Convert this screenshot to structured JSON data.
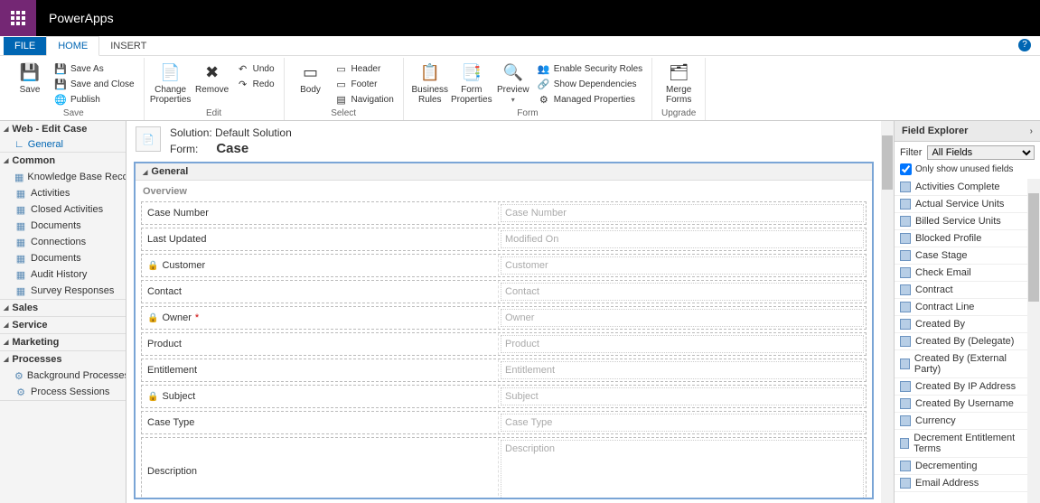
{
  "app_title": "PowerApps",
  "tabs": {
    "file": "FILE",
    "home": "HOME",
    "insert": "INSERT"
  },
  "ribbon": {
    "save": {
      "save": "Save",
      "saveas": "Save As",
      "saveclose": "Save and Close",
      "publish": "Publish",
      "group": "Save"
    },
    "edit": {
      "change": "Change Properties",
      "remove": "Remove",
      "undo": "Undo",
      "redo": "Redo",
      "group": "Edit"
    },
    "select": {
      "body": "Body",
      "header": "Header",
      "footer": "Footer",
      "nav": "Navigation",
      "group": "Select"
    },
    "form": {
      "rules": "Business Rules",
      "props": "Form Properties",
      "preview": "Preview",
      "security": "Enable Security Roles",
      "deps": "Show Dependencies",
      "managed": "Managed Properties",
      "group": "Form"
    },
    "upgrade": {
      "merge": "Merge Forms",
      "group": "Upgrade"
    }
  },
  "leftpane": {
    "web": "Web - Edit Case",
    "general": "General",
    "common": {
      "head": "Common",
      "items": [
        "Knowledge Base Reco...",
        "Activities",
        "Closed Activities",
        "Documents",
        "Connections",
        "Documents",
        "Audit History",
        "Survey Responses"
      ]
    },
    "sales": "Sales",
    "service": "Service",
    "marketing": "Marketing",
    "processes": {
      "head": "Processes",
      "items": [
        "Background Processes",
        "Process Sessions"
      ]
    }
  },
  "canvas": {
    "solution_label": "Solution:",
    "solution": "Default Solution",
    "form_label": "Form:",
    "form": "Case",
    "section": "General",
    "overview": "Overview",
    "fields": [
      {
        "label": "Case Number",
        "ph": "Case Number",
        "req": false
      },
      {
        "label": "Last Updated",
        "ph": "Modified On",
        "req": false
      },
      {
        "label": "Customer",
        "ph": "Customer",
        "req": true
      },
      {
        "label": "Contact",
        "ph": "Contact",
        "req": false
      },
      {
        "label": "Owner",
        "ph": "Owner",
        "req": true,
        "star": true
      },
      {
        "label": "Product",
        "ph": "Product",
        "req": false
      },
      {
        "label": "Entitlement",
        "ph": "Entitlement",
        "req": false
      },
      {
        "label": "Subject",
        "ph": "Subject",
        "req": true
      },
      {
        "label": "Case Type",
        "ph": "Case Type",
        "req": false
      },
      {
        "label": "Description",
        "ph": "Description",
        "req": false,
        "tall": true
      }
    ]
  },
  "fieldexplorer": {
    "title": "Field Explorer",
    "filter_label": "Filter",
    "filter_value": "All Fields",
    "unused_label": "Only show unused fields",
    "unused_checked": true,
    "items": [
      "Activities Complete",
      "Actual Service Units",
      "Billed Service Units",
      "Blocked Profile",
      "Case Stage",
      "Check Email",
      "Contract",
      "Contract Line",
      "Created By",
      "Created By (Delegate)",
      "Created By (External Party)",
      "Created By IP Address",
      "Created By Username",
      "Currency",
      "Decrement Entitlement Terms",
      "Decrementing",
      "Email Address"
    ]
  }
}
